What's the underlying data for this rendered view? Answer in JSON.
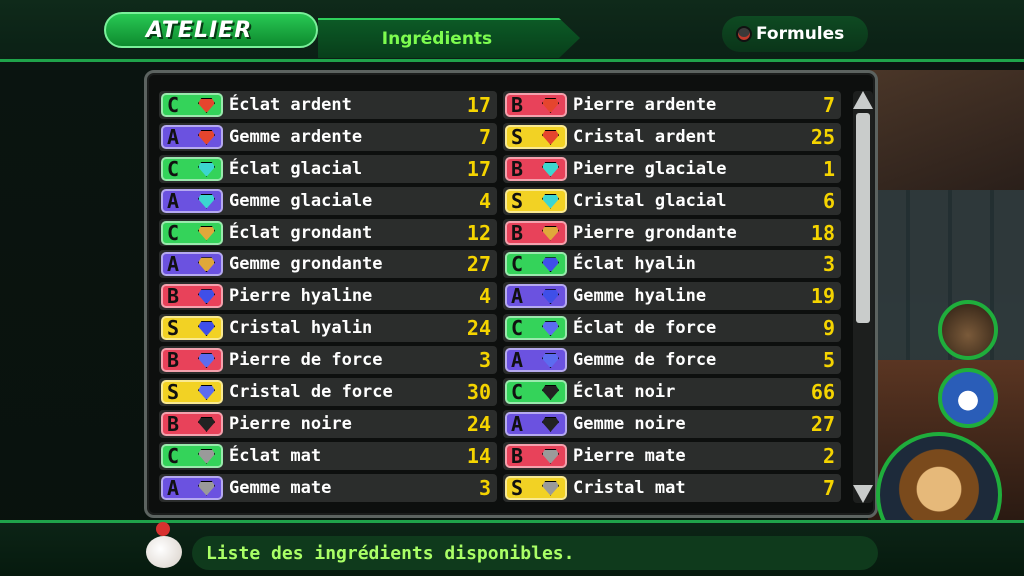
{
  "header": {
    "title": "ATELIER",
    "active_tab": "Ingrédients",
    "other_tab": "Formules"
  },
  "rank_colors": {
    "C": "#34d35a",
    "B": "#e8425a",
    "A": "#6b52e0",
    "S": "#f2d224"
  },
  "gem_colors": {
    "ardent": "#e5452e",
    "glacial": "#3cd6d0",
    "grondant": "#e0a83a",
    "hyalin": "#3f4fe8",
    "force": "#5c6cf0",
    "noir": "#222222",
    "mat": "#9a9a9a"
  },
  "items": [
    {
      "rank": "C",
      "gem": "ardent",
      "name": "Éclat ardent",
      "count": "17"
    },
    {
      "rank": "B",
      "gem": "ardent",
      "name": "Pierre ardente",
      "count": "7"
    },
    {
      "rank": "A",
      "gem": "ardent",
      "name": "Gemme ardente",
      "count": "7"
    },
    {
      "rank": "S",
      "gem": "ardent",
      "name": "Cristal ardent",
      "count": "25"
    },
    {
      "rank": "C",
      "gem": "glacial",
      "name": "Éclat glacial",
      "count": "17"
    },
    {
      "rank": "B",
      "gem": "glacial",
      "name": "Pierre glaciale",
      "count": "1"
    },
    {
      "rank": "A",
      "gem": "glacial",
      "name": "Gemme glaciale",
      "count": "4"
    },
    {
      "rank": "S",
      "gem": "glacial",
      "name": "Cristal glacial",
      "count": "6"
    },
    {
      "rank": "C",
      "gem": "grondant",
      "name": "Éclat grondant",
      "count": "12"
    },
    {
      "rank": "B",
      "gem": "grondant",
      "name": "Pierre grondante",
      "count": "18"
    },
    {
      "rank": "A",
      "gem": "grondant",
      "name": "Gemme grondante",
      "count": "27"
    },
    {
      "rank": "C",
      "gem": "hyalin",
      "name": "Éclat hyalin",
      "count": "3"
    },
    {
      "rank": "B",
      "gem": "hyalin",
      "name": "Pierre hyaline",
      "count": "4"
    },
    {
      "rank": "A",
      "gem": "hyalin",
      "name": "Gemme hyaline",
      "count": "19"
    },
    {
      "rank": "S",
      "gem": "hyalin",
      "name": "Cristal hyalin",
      "count": "24"
    },
    {
      "rank": "C",
      "gem": "force",
      "name": "Éclat de force",
      "count": "9"
    },
    {
      "rank": "B",
      "gem": "force",
      "name": "Pierre de force",
      "count": "3"
    },
    {
      "rank": "A",
      "gem": "force",
      "name": "Gemme de force",
      "count": "5"
    },
    {
      "rank": "S",
      "gem": "force",
      "name": "Cristal de force",
      "count": "30"
    },
    {
      "rank": "C",
      "gem": "noir",
      "name": "Éclat noir",
      "count": "66"
    },
    {
      "rank": "B",
      "gem": "noir",
      "name": "Pierre noire",
      "count": "24"
    },
    {
      "rank": "A",
      "gem": "noir",
      "name": "Gemme noire",
      "count": "27"
    },
    {
      "rank": "C",
      "gem": "mat",
      "name": "Éclat mat",
      "count": "14"
    },
    {
      "rank": "B",
      "gem": "mat",
      "name": "Pierre mate",
      "count": "2"
    },
    {
      "rank": "A",
      "gem": "mat",
      "name": "Gemme mate",
      "count": "3"
    },
    {
      "rank": "S",
      "gem": "mat",
      "name": "Cristal mat",
      "count": "7"
    }
  ],
  "help_text": "Liste des ingrédients disponibles.",
  "icons": {
    "formules_button": "controller-button-icon",
    "moogle": "moogle-icon",
    "scroll_up": "scroll-up-arrow-icon",
    "scroll_down": "scroll-down-arrow-icon"
  }
}
